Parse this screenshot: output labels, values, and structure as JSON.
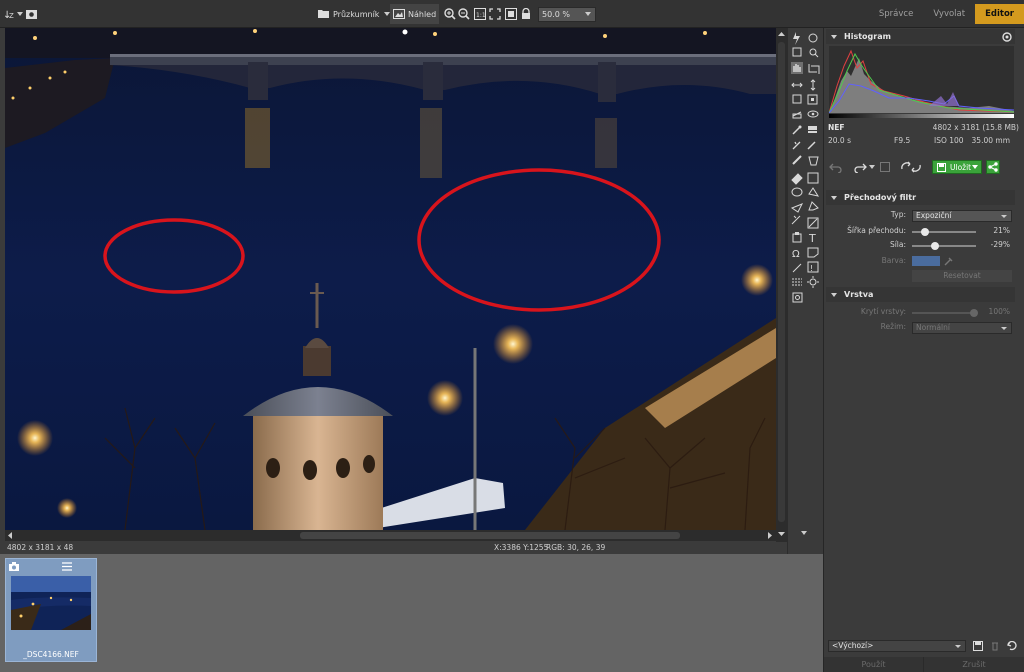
{
  "toolbar": {
    "browser_label": "Průzkumník",
    "preview_label": "Náhled",
    "zoom_value": "50.0 %"
  },
  "modes": {
    "manage": "Správce",
    "develop": "Vyvolat",
    "editor": "Editor"
  },
  "photo": {
    "description_colors": {
      "water": "#0b1a44",
      "ellipse": "#d8141c",
      "light": "#ffcf6a"
    }
  },
  "status": {
    "dims": "4802 x 3181 x 48",
    "coords": "X:3386 Y:1255",
    "rgb": "RGB: 30, 26, 39"
  },
  "filmstrip": {
    "items": [
      {
        "name": "_DSC4166.NEF"
      }
    ]
  },
  "histogram": {
    "title": "Histogram",
    "format": "NEF",
    "size": "4802 x 3181 (15.8 MB)",
    "shutter": "20.0 s",
    "aperture": "F9.5",
    "iso": "ISO 100",
    "focal": "35.00 mm"
  },
  "actions": {
    "save": "Uložit"
  },
  "gradient_filter": {
    "title": "Přechodový filtr",
    "type_label": "Typ:",
    "type_value": "Expoziční",
    "width_label": "Šířka přechodu:",
    "width_value": "21%",
    "width_pos": 0.21,
    "strength_label": "Síla:",
    "strength_value": "-29%",
    "strength_pos": 0.355,
    "color_label": "Barva:",
    "reset_label": "Resetovat"
  },
  "layer": {
    "title": "Vrstva",
    "opacity_label": "Krytí vrstvy:",
    "opacity_value": "100%",
    "mode_label": "Režim:",
    "mode_value": "Normální"
  },
  "bottom": {
    "preset": "<Výchozí>",
    "apply": "Použít",
    "cancel": "Zrušit"
  }
}
